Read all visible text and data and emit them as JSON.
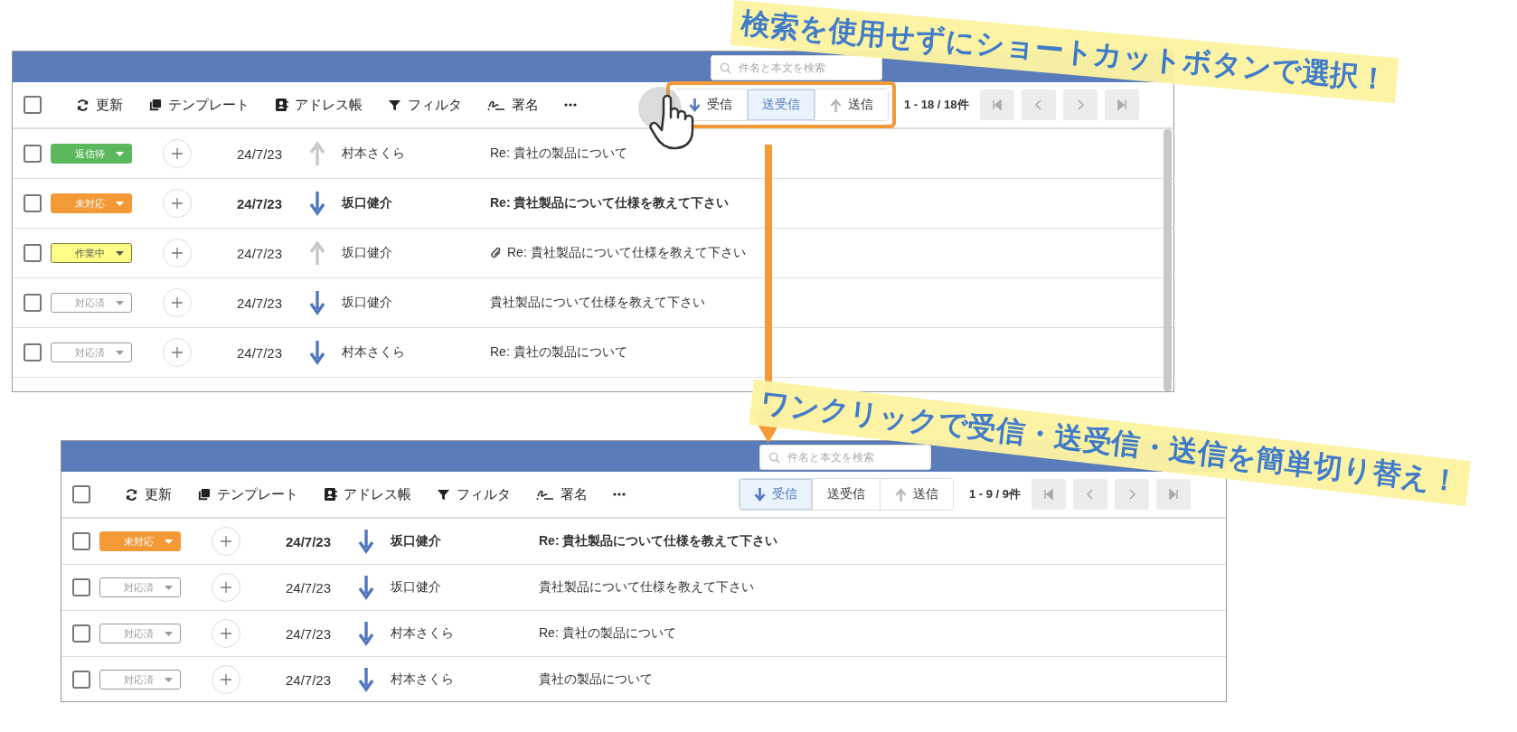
{
  "panels": [
    {
      "highlighted": true,
      "search": {
        "placeholder": "件名と本文を検索"
      },
      "select_all": {
        "checked": false
      },
      "toolbar": [
        {
          "kind": "refresh",
          "label": "更新"
        },
        {
          "kind": "template",
          "label": "テンプレート"
        },
        {
          "kind": "address",
          "label": "アドレス帳"
        },
        {
          "kind": "filter",
          "label": "フィルタ"
        },
        {
          "kind": "signature",
          "label": "署名"
        },
        {
          "kind": "more"
        }
      ],
      "direction_tabs": [
        {
          "kind": "in",
          "label": "受信",
          "selected": false
        },
        {
          "kind": "both",
          "label": "送受信",
          "selected": true
        },
        {
          "kind": "out",
          "label": "送信",
          "selected": false
        }
      ],
      "page_info": "1 - 18 / 18件",
      "rows": [
        {
          "checked": false,
          "status": "返信待",
          "color": "#5cb85c",
          "date": "24/7/23",
          "kind": "sent",
          "sender": "村本さくら",
          "subject": "Re: 貴社の製品について",
          "unread": false,
          "attachment": false
        },
        {
          "checked": false,
          "status": "未対応",
          "color": "#f39a37",
          "date": "24/7/23",
          "kind": "received",
          "sender": "坂口健介",
          "subject": "Re: 貴社製品について仕様を教えて下さい",
          "unread": true,
          "attachment": false
        },
        {
          "checked": false,
          "status": "作業中",
          "color": "#ffff88",
          "date": "24/7/23",
          "kind": "sent",
          "sender": "坂口健介",
          "subject": "Re: 貴社製品について仕様を教えて下さい",
          "unread": false,
          "attachment": true
        },
        {
          "checked": false,
          "status": "対応済",
          "color": "#ffffff",
          "date": "24/7/23",
          "kind": "received",
          "sender": "坂口健介",
          "subject": "貴社製品について仕様を教えて下さい",
          "unread": false,
          "attachment": false
        },
        {
          "checked": false,
          "status": "対応済",
          "color": "#ffffff",
          "date": "24/7/23",
          "kind": "received",
          "sender": "村本さくら",
          "subject": "Re: 貴社の製品について",
          "unread": false,
          "attachment": false
        }
      ]
    },
    {
      "highlighted": false,
      "search": {
        "placeholder": "件名と本文を検索"
      },
      "select_all": {
        "checked": false
      },
      "toolbar": [
        {
          "kind": "refresh",
          "label": "更新"
        },
        {
          "kind": "template",
          "label": "テンプレート"
        },
        {
          "kind": "address",
          "label": "アドレス帳"
        },
        {
          "kind": "filter",
          "label": "フィルタ"
        },
        {
          "kind": "signature",
          "label": "署名"
        },
        {
          "kind": "more"
        }
      ],
      "direction_tabs": [
        {
          "kind": "in",
          "label": "受信",
          "selected": true
        },
        {
          "kind": "both",
          "label": "送受信",
          "selected": false
        },
        {
          "kind": "out",
          "label": "送信",
          "selected": false
        }
      ],
      "page_info": "1 - 9 / 9件",
      "rows": [
        {
          "checked": false,
          "status": "未対応",
          "color": "#f39a37",
          "date": "24/7/23",
          "kind": "received",
          "sender": "坂口健介",
          "subject": "Re: 貴社製品について仕様を教えて下さい",
          "unread": true,
          "attachment": false
        },
        {
          "checked": false,
          "status": "対応済",
          "color": "#ffffff",
          "date": "24/7/23",
          "kind": "received",
          "sender": "坂口健介",
          "subject": "貴社製品について仕様を教えて下さい",
          "unread": false,
          "attachment": false
        },
        {
          "checked": false,
          "status": "対応済",
          "color": "#ffffff",
          "date": "24/7/23",
          "kind": "received",
          "sender": "村本さくら",
          "subject": "Re: 貴社の製品について",
          "unread": false,
          "attachment": false
        },
        {
          "checked": false,
          "status": "対応済",
          "color": "#ffffff",
          "date": "24/7/23",
          "kind": "received",
          "sender": "村本さくら",
          "subject": "貴社の製品について",
          "unread": false,
          "attachment": false
        }
      ]
    }
  ],
  "callouts": [
    "検索を使用せずにショートカットボタンで選択！",
    "ワンクリックで受信・送受信・送信を簡単切り替え！"
  ]
}
